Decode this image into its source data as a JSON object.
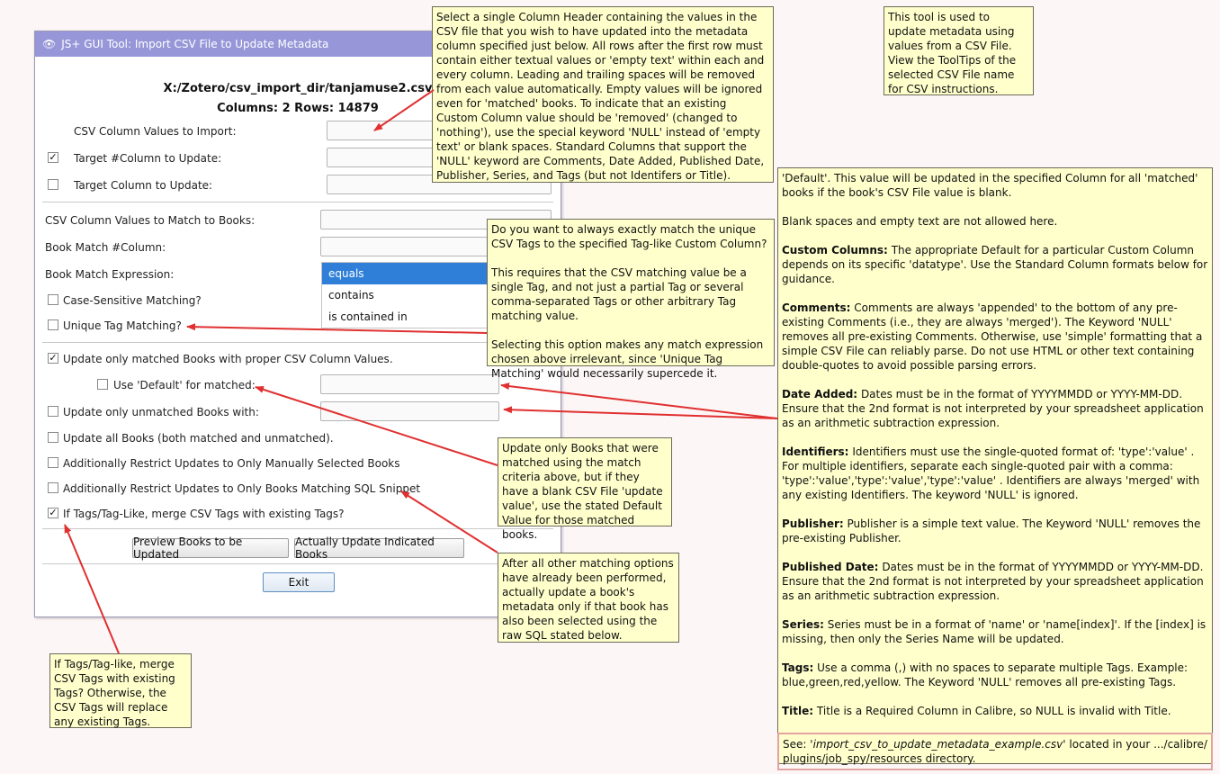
{
  "window": {
    "title": "JS+ GUI Tool:  Import CSV File to Update Metadata",
    "file_path": "X:/Zotero/csv_import_dir/tanjamuse2.csv",
    "stats": "Columns: 2  Rows: 14879"
  },
  "form": {
    "csv_values_to_import": "CSV Column Values to Import:",
    "target_hash_column": "Target #Column to Update:",
    "target_column": "Target Column to Update:",
    "csv_values_to_match": "CSV Column Values to Match to Books:",
    "book_match_hash_column": "Book Match #Column:",
    "book_match_expression": "Book Match Expression:",
    "case_sensitive": "Case-Sensitive Matching?",
    "unique_tag": "Unique Tag Matching?",
    "update_matched": "Update only matched Books with proper CSV Column Values.",
    "use_default": "Use 'Default' for matched:",
    "update_unmatched": "Update only unmatched Books with:",
    "update_all": "Update all Books (both matched and unmatched).",
    "restrict_manual": "Additionally Restrict Updates to Only Manually Selected Books",
    "restrict_sql": "Additionally Restrict Updates to Only Books Matching SQL Snippet",
    "merge_tags": "If Tags/Tag-Like, merge CSV Tags with existing Tags?",
    "match_options": [
      "equals",
      "contains",
      "is contained in"
    ]
  },
  "buttons": {
    "preview": "Preview Books to be Updated",
    "update": "Actually Update Indicated Books",
    "exit": "Exit"
  },
  "checks": {
    "mark": "✓"
  },
  "tooltips": {
    "csv_values": "Select a single Column Header containing the values in the CSV file that you wish to have updated into the metadata column specified just below. All rows after the first row must contain either textual values or 'empty text' within each and every column. Leading and trailing spaces will be removed from each value automatically. Empty values will be ignored even for 'matched' books. To indicate that an existing Custom Column value should be 'removed' (changed to 'nothing'), use the special keyword 'NULL' instead of 'empty text' or blank spaces. Standard Columns that support the 'NULL' keyword are Comments, Date Added, Published Date, Publisher, Series, and Tags (but not Identifers or Title).",
    "tool_info": "This tool is used to update metadata using values from a CSV File. View the ToolTips of the selected CSV File name for CSV instructions.",
    "unique_tag": [
      "Do you want to always exactly match the unique CSV Tags to the specified Tag-like Custom Column?",
      "This requires that the CSV matching value be a single Tag, and not just a partial Tag or several comma-separated Tags or other arbitrary Tag matching value.",
      "Selecting this option makes any match expression chosen above irrelevant, since 'Unique Tag Matching' would necessarily supercede it."
    ],
    "use_default": "Update only Books that were matched using the match criteria above, but if they have a blank CSV File 'update value', use the stated Default Value for those matched books.",
    "sql_restrict": "After all other matching options have already been performed, actually update a book's metadata only if that book has also been selected using the raw SQL stated below.",
    "merge_tags": "If Tags/Tag-like, merge CSV Tags with existing Tags? Otherwise, the CSV Tags will replace any existing Tags.",
    "default_intro_1": "'Default'. This value will be updated in the specified Column for all 'matched' books if the book's CSV File value is blank.",
    "default_intro_2": "Blank spaces and empty text are not allowed here.",
    "custom_head": "Custom Columns:",
    "custom_body": "The appropriate Default for a particular Custom Column depends on its specific 'datatype'. Use the Standard Column formats below for guidance.",
    "comments_head": "Comments:",
    "comments_body": "Comments are always 'appended' to the bottom of any pre-existing Comments (i.e., they are always 'merged'). The Keyword 'NULL' removes all pre-existing Comments. Otherwise, use 'simple' formatting that a simple CSV File can reliably parse. Do not use HTML or other text containing double-quotes to avoid possible parsing errors.",
    "date_added_head": "Date Added:",
    "date_added_body": "Dates must be in the format of YYYYMMDD or YYYY-MM-DD. Ensure that the 2nd format is not interpreted by your spreadsheet application as an arithmetic subtraction expression.",
    "identifiers_head": "Identifiers:",
    "identifiers_body": "Identifiers must use the single-quoted format of: 'type':'value' . For multiple identifiers, separate each single-quoted pair with a comma: 'type':'value','type':'value','type':'value' . Identifiers are always 'merged' with any existing Identifiers. The keyword 'NULL' is ignored.",
    "publisher_head": "Publisher:",
    "publisher_body": "Publisher is a simple text value. The Keyword 'NULL' removes the pre-existing Publisher.",
    "published_head": "Published Date:",
    "published_body": "Dates must be in the format of YYYYMMDD or YYYY-MM-DD. Ensure that the 2nd format is not interpreted by your spreadsheet application as an arithmetic subtraction expression.",
    "series_head": "Series:",
    "series_body": "Series must be in a format of 'name' or 'name[index]'. If the [index] is missing, then only the Series Name will be updated.",
    "tags_head": "Tags:",
    "tags_body": "Use a comma (,) with no spaces to separate multiple Tags. Example: blue,green,red,yellow. The Keyword 'NULL' removes all pre-existing Tags.",
    "title_head": "Title:",
    "title_body": "Title is a Required Column in Calibre, so NULL is invalid with Title.",
    "see_label": "See:",
    "see_file": "'import_csv_to_update_metadata_example.csv'",
    "see_rest": "located in your .../calibre/ plugins/job_spy/resources directory."
  },
  "colors": {
    "titlebar": "#9696d8",
    "tooltip_bg": "#ffffcc",
    "arrow": "#e03030",
    "selection": "#2f7fd8"
  }
}
